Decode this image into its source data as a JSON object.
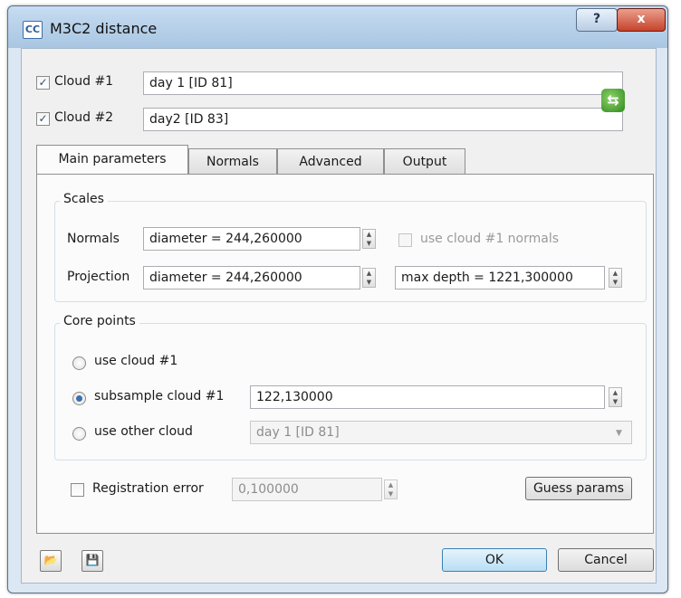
{
  "window": {
    "title": "M3C2 distance",
    "app_icon": "CC",
    "help_glyph": "?",
    "close_glyph": "x"
  },
  "clouds": {
    "cloud1": {
      "label": "Cloud #1",
      "checked": true,
      "value": "day 1 [ID 81]"
    },
    "cloud2": {
      "label": "Cloud #2",
      "checked": true,
      "value": "day2 [ID 83]"
    },
    "swap_icon": "swap-clouds-icon"
  },
  "tabs": [
    {
      "label": "Main parameters",
      "active": true
    },
    {
      "label": "Normals",
      "active": false
    },
    {
      "label": "Advanced",
      "active": false
    },
    {
      "label": "Output",
      "active": false
    }
  ],
  "scales": {
    "title": "Scales",
    "normals": {
      "label": "Normals",
      "value": "diameter = 244,260000"
    },
    "use_cloud1_normals": {
      "label": "use cloud #1 normals",
      "checked": false,
      "enabled": false
    },
    "projection": {
      "label": "Projection",
      "value": "diameter = 244,260000"
    },
    "max_depth": {
      "value": "max depth = 1221,300000"
    }
  },
  "core_points": {
    "title": "Core points",
    "use_cloud1": {
      "label": "use cloud #1",
      "checked": false
    },
    "subsample": {
      "label": "subsample cloud #1",
      "checked": true,
      "value": "122,130000"
    },
    "use_other": {
      "label": "use other cloud",
      "checked": false,
      "value": "day 1 [ID 81]"
    }
  },
  "registration": {
    "label": "Registration error",
    "checked": false,
    "value": "0,100000"
  },
  "buttons": {
    "guess": "Guess params",
    "ok": "OK",
    "cancel": "Cancel"
  },
  "footer_icons": [
    "load-params-icon",
    "save-params-icon"
  ],
  "colors": {
    "title_bar": "#b4cfe9",
    "close_button": "#c6422a",
    "ok_button": "#b9def4"
  }
}
